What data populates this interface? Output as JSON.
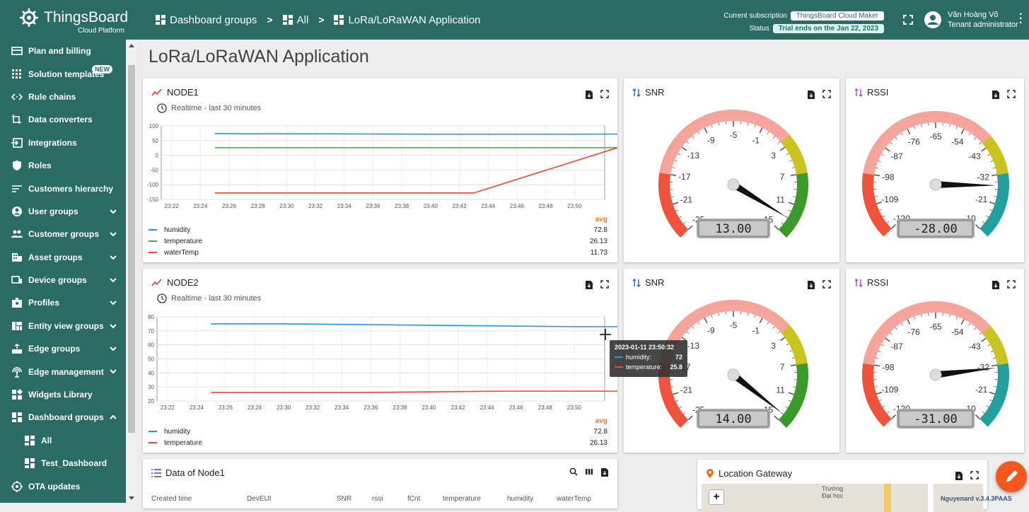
{
  "brand": {
    "name": "ThingsBoard",
    "sub": "Cloud Platform"
  },
  "breadcrumb": {
    "items": [
      "Dashboard groups",
      "All",
      "LoRa/LoRaWAN Application"
    ]
  },
  "subscription": {
    "label": "Current subscription",
    "plan": "ThingsBoard Cloud Maker",
    "status_label": "Status",
    "status": "Trial ends on the Jan 22, 2023"
  },
  "user": {
    "name": "Văn Hoàng Võ",
    "role": "Tenant administrator"
  },
  "sidebar": {
    "items": [
      {
        "label": "Plan and billing",
        "icon": "billing-icon"
      },
      {
        "label": "Solution templates",
        "icon": "apps-icon",
        "badge": "NEW"
      },
      {
        "label": "Rule chains",
        "icon": "code-icon"
      },
      {
        "label": "Data converters",
        "icon": "transform-icon"
      },
      {
        "label": "Integrations",
        "icon": "input-icon"
      },
      {
        "label": "Roles",
        "icon": "shield-icon"
      },
      {
        "label": "Customers hierarchy",
        "icon": "sort-icon"
      },
      {
        "label": "User groups",
        "icon": "account-icon",
        "chev": "down"
      },
      {
        "label": "Customer groups",
        "icon": "group-icon",
        "chev": "down"
      },
      {
        "label": "Asset groups",
        "icon": "domain-icon",
        "chev": "down"
      },
      {
        "label": "Device groups",
        "icon": "devices-icon",
        "chev": "down"
      },
      {
        "label": "Profiles",
        "icon": "badge-icon",
        "chev": "down"
      },
      {
        "label": "Entity view groups",
        "icon": "view-quilt-icon",
        "chev": "down"
      },
      {
        "label": "Edge groups",
        "icon": "router-icon",
        "chev": "down"
      },
      {
        "label": "Edge management",
        "icon": "settings-input-antenna-icon",
        "chev": "down"
      },
      {
        "label": "Widgets Library",
        "icon": "widgets-icon"
      },
      {
        "label": "Dashboard groups",
        "icon": "dashboard-icon",
        "chev": "up"
      },
      {
        "label": "All",
        "icon": "dashboard-icon",
        "sub": true
      },
      {
        "label": "Test_Dashboard",
        "icon": "dashboard-icon",
        "sub": true
      },
      {
        "label": "OTA updates",
        "icon": "memory-icon"
      }
    ]
  },
  "page": {
    "title": "LoRa/LoRaWAN Application"
  },
  "node1": {
    "title": "NODE1",
    "timewindow": "Realtime - last 30 minutes",
    "avg_label": "avg",
    "legend": [
      {
        "name": "humidity",
        "value": "72.8",
        "color": "#2196f3"
      },
      {
        "name": "temperature",
        "value": "26.13",
        "color": "#4caf50"
      },
      {
        "name": "waterTemp",
        "value": "11.73",
        "color": "#f44336"
      }
    ]
  },
  "node2": {
    "title": "NODE2",
    "timewindow": "Realtime - last 30 minutes",
    "avg_label": "avg",
    "legend": [
      {
        "name": "humidity",
        "value": "72.8",
        "color": "#2196f3"
      },
      {
        "name": "temperature",
        "value": "26.13",
        "color": "#f44336"
      }
    ]
  },
  "chart_data": [
    {
      "type": "line",
      "title": "NODE1",
      "x": [
        "23:22",
        "23:24",
        "23:26",
        "23:28",
        "23:30",
        "23:32",
        "23:34",
        "23:36",
        "23:38",
        "23:40",
        "23:42",
        "23:44",
        "23:46",
        "23:48",
        "23:50"
      ],
      "ylim": [
        -150,
        100
      ],
      "yticks": [
        100,
        50,
        0,
        -50,
        -100,
        -150
      ],
      "series": [
        {
          "name": "humidity",
          "color": "#2196f3",
          "points": [
            [
              23.25,
              74
            ],
            [
              23.27,
              73
            ],
            [
              23.3,
              73
            ],
            [
              23.4,
              72
            ],
            [
              23.5,
              72
            ],
            [
              23.6,
              73
            ],
            [
              23.7,
              73
            ],
            [
              23.8,
              73
            ],
            [
              23.9,
              73
            ],
            [
              24.15,
              72
            ]
          ]
        },
        {
          "name": "temperature",
          "color": "#4caf50",
          "points": [
            [
              23.25,
              26
            ],
            [
              23.45,
              26
            ],
            [
              23.6,
              26
            ],
            [
              24.15,
              26
            ]
          ]
        },
        {
          "name": "waterTemp",
          "color": "#f44336",
          "points": [
            [
              23.25,
              -128
            ],
            [
              23.43,
              -128
            ],
            [
              23.53,
              26
            ],
            [
              23.7,
              26
            ],
            [
              24.15,
              26
            ]
          ]
        }
      ]
    },
    {
      "type": "line",
      "title": "NODE2",
      "x": [
        "23:22",
        "23:24",
        "23:26",
        "23:28",
        "23:30",
        "23:32",
        "23:34",
        "23:36",
        "23:38",
        "23:40",
        "23:42",
        "23:44",
        "23:46",
        "23:48",
        "23:50"
      ],
      "ylim": [
        20,
        80
      ],
      "yticks": [
        80,
        70,
        60,
        50,
        40,
        30,
        20
      ],
      "series": [
        {
          "name": "humidity",
          "color": "#2196f3",
          "points": [
            [
              23.25,
              75
            ],
            [
              23.3,
              75
            ],
            [
              23.4,
              74
            ],
            [
              23.5,
              73
            ],
            [
              23.6,
              73
            ],
            [
              23.7,
              72.5
            ],
            [
              23.8,
              72
            ],
            [
              23.9,
              72
            ],
            [
              23.95,
              73
            ],
            [
              24.0,
              73
            ],
            [
              24.1,
              73
            ],
            [
              24.15,
              73
            ],
            [
              24.2,
              73
            ],
            [
              24.25,
              72
            ],
            [
              24.35,
              73
            ],
            [
              24.4,
              73
            ],
            [
              24.45,
              73
            ],
            [
              24.5,
              73
            ],
            [
              24.55,
              72
            ],
            [
              24.57,
              72
            ]
          ]
        },
        {
          "name": "temperature",
          "color": "#f44336",
          "points": [
            [
              23.25,
              26
            ],
            [
              23.35,
              26
            ],
            [
              23.45,
              27
            ],
            [
              23.55,
              27
            ],
            [
              23.7,
              26.5
            ],
            [
              23.9,
              26
            ],
            [
              24.1,
              26
            ],
            [
              24.3,
              26
            ],
            [
              24.45,
              26
            ],
            [
              24.57,
              26
            ]
          ]
        }
      ]
    }
  ],
  "gauges": [
    {
      "title": "SNR",
      "value": 13,
      "display": "13.00",
      "min": -25,
      "max": 15,
      "ticks": [
        "-25",
        "-21",
        "-17",
        "-13",
        "-9",
        "-5",
        "-1",
        "3",
        "7",
        "11",
        "15"
      ]
    },
    {
      "title": "RSSI",
      "value": -28,
      "display": "-28.00",
      "min": -120,
      "max": -10,
      "ticks": [
        "-120",
        "-109",
        "-98",
        "-87",
        "-76",
        "-65",
        "-54",
        "-43",
        "-32",
        "-21",
        "-10"
      ]
    },
    {
      "title": "SNR",
      "value": 14,
      "display": "14.00",
      "min": -25,
      "max": 15,
      "ticks": [
        "-25",
        "-21",
        "-17",
        "-13",
        "-9",
        "-5",
        "-1",
        "3",
        "7",
        "11",
        "15"
      ]
    },
    {
      "title": "RSSI",
      "value": -31,
      "display": "-31.00",
      "min": -120,
      "max": -10,
      "ticks": [
        "-120",
        "-109",
        "-98",
        "-87",
        "-76",
        "-65",
        "-54",
        "-43",
        "-32",
        "-21",
        "-10"
      ]
    }
  ],
  "tooltip": {
    "time": "2023-01-11 23:50:32",
    "rows": [
      {
        "name": "humidity:",
        "value": "72",
        "color": "#2196f3"
      },
      {
        "name": "temperature:",
        "value": "25.8",
        "color": "#f44336"
      }
    ]
  },
  "table": {
    "title": "Data of Node1",
    "columns": [
      "Created time",
      "DevEUI",
      "SNR",
      "rssi",
      "fCnt",
      "temperature",
      "humidity",
      "waterTemp"
    ]
  },
  "map": {
    "title": "Location Gateway",
    "label1": "Trường",
    "label2": "Đại học"
  },
  "version": "Nguyenard v.3.4.3PAAS"
}
